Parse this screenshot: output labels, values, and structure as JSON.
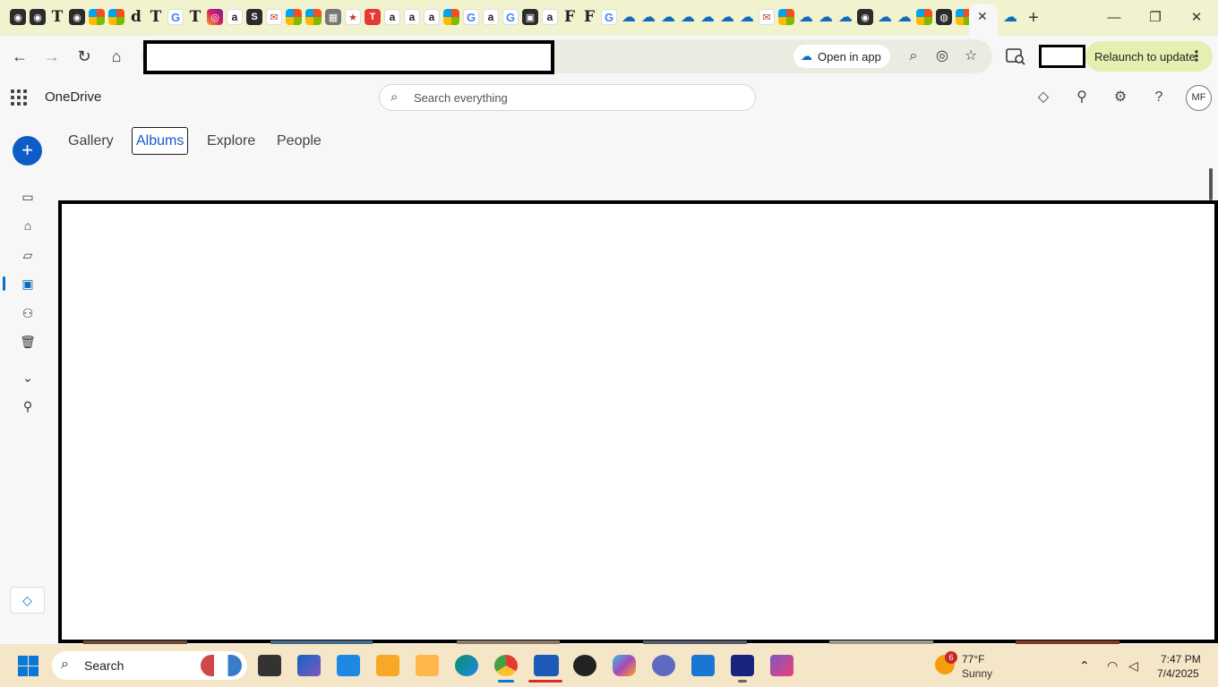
{
  "browser": {
    "tab_favicons": [
      "chrome",
      "chrome",
      "T",
      "edge",
      "ms",
      "ms",
      "d",
      "T",
      "G",
      "T",
      "insta",
      "a",
      "sheets",
      "mail",
      "ms",
      "ms",
      "grey",
      "star",
      "red",
      "a",
      "a",
      "a",
      "ms",
      "G",
      "a",
      "G",
      "bag",
      "a",
      "F",
      "F",
      "G",
      "cloud",
      "cloud",
      "cloud",
      "cloud",
      "cloud",
      "cloud",
      "cloud",
      "mail",
      "ms",
      "cloud",
      "cloud",
      "cloud",
      "chrome",
      "cloud",
      "cloud",
      "ms",
      "globe",
      "ms"
    ],
    "active_tab_close": "✕",
    "new_tab": "+",
    "window_controls": {
      "minimize": "—",
      "maximize": "❐",
      "close": "✕"
    },
    "open_in_app_label": "Open in app",
    "relaunch_label": "Relaunch to update"
  },
  "onedrive": {
    "app_title": "OneDrive",
    "search_placeholder": "Search everything",
    "avatar_initials": "MF",
    "tabs": [
      {
        "label": "Gallery",
        "active": false
      },
      {
        "label": "Albums",
        "active": true
      },
      {
        "label": "Explore",
        "active": false
      },
      {
        "label": "People",
        "active": false
      }
    ],
    "rail_items": [
      "new",
      "my-files",
      "home",
      "folder",
      "photos",
      "shared",
      "recycle-bin",
      "more",
      "account"
    ]
  },
  "taskbar": {
    "search_label": "Search",
    "weather": {
      "badge": "6",
      "temp": "77°F",
      "condition": "Sunny"
    },
    "time": "7:47 PM",
    "date": "7/4/2025"
  },
  "colors": {
    "accent": "#0f5cc9",
    "tabstrip": "#f1f3cf",
    "relaunch_bg": "#e5efb0",
    "taskbar": "#f4e6c7"
  }
}
